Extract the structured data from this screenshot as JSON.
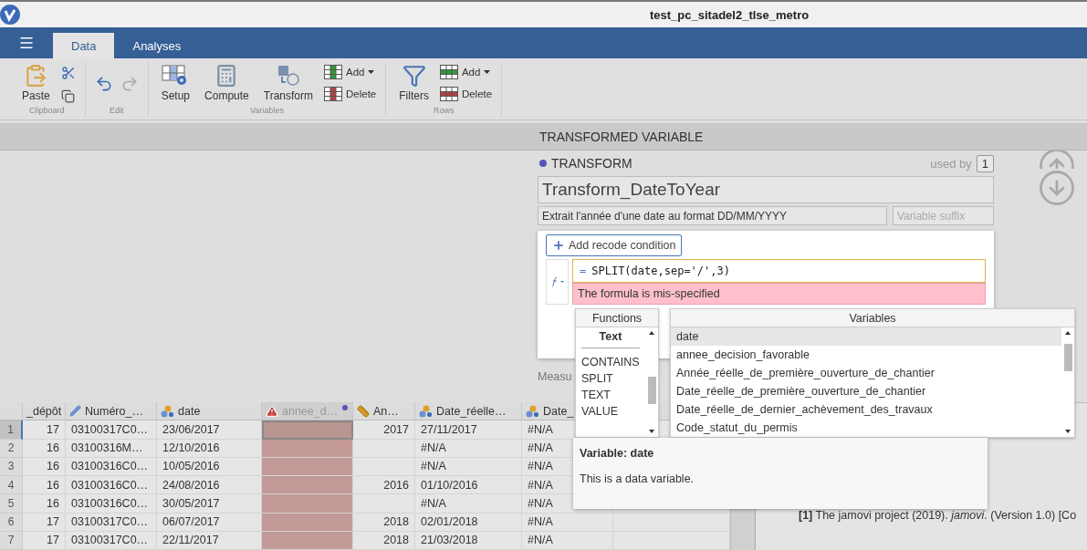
{
  "window": {
    "title": "test_pc_sitadel2_tlse_metro"
  },
  "tabs": [
    {
      "label": "Data",
      "selected": true
    },
    {
      "label": "Analyses",
      "selected": false
    }
  ],
  "ribbon": {
    "groups": [
      {
        "label": "Clipboard",
        "buttons": [
          {
            "kind": "paste",
            "label": "Paste"
          },
          {
            "kind": "cut"
          },
          {
            "kind": "copy"
          }
        ]
      },
      {
        "label": "Edit",
        "buttons": [
          {
            "kind": "undo",
            "disabled": false
          },
          {
            "kind": "redo",
            "disabled": true
          }
        ]
      },
      {
        "label": "Variables",
        "buttons": [
          {
            "kind": "setup",
            "label": "Setup"
          },
          {
            "kind": "compute",
            "label": "Compute"
          },
          {
            "kind": "transform",
            "label": "Transform"
          },
          {
            "kind": "add-col",
            "label": "Add"
          },
          {
            "kind": "delete-col",
            "label": "Delete"
          }
        ]
      },
      {
        "label": "Rows",
        "buttons": [
          {
            "kind": "filters",
            "label": "Filters"
          },
          {
            "kind": "add-row",
            "label": "Add"
          },
          {
            "kind": "delete-row",
            "label": "Delete"
          }
        ]
      }
    ]
  },
  "panel": {
    "title": "TRANSFORMED VARIABLE",
    "transform": {
      "heading": "TRANSFORM",
      "color": "#5555b8",
      "used_by_label": "used by",
      "used_by_count": "1",
      "name": "Transform_DateToYear",
      "description": "Extrait l'année d'une date au format DD/MM/YYYY",
      "suffix_placeholder": "Variable suffix",
      "add_condition": "Add recode condition",
      "formula_prefix": "=",
      "formula": "SPLIT(date,sep='/',3)",
      "error": "The formula is mis-specified"
    },
    "measure_label": "Measu"
  },
  "formula_popup": {
    "functions": {
      "title": "Functions",
      "category": "Text",
      "items": [
        "CONTAINS",
        "SPLIT",
        "TEXT",
        "VALUE"
      ]
    },
    "variables": {
      "title": "Variables",
      "items": [
        {
          "label": "date",
          "selected": true
        },
        {
          "label": "annee_decision_favorable",
          "selected": false
        },
        {
          "label": "Année_réelle_de_première_ouverture_de_chantier",
          "selected": false
        },
        {
          "label": "Date_réelle_de_première_ouverture_de_chantier",
          "selected": false
        },
        {
          "label": "Date_réelle_de_dernier_achèvement_des_travaux",
          "selected": false
        },
        {
          "label": "Code_statut_du_permis",
          "selected": false
        }
      ]
    },
    "detail_title": "Variable: date",
    "detail_text": "This is a data variable."
  },
  "table": {
    "columns": [
      {
        "label": "_dépôt",
        "kind": "plain"
      },
      {
        "label": "Numéro_…",
        "kind": "id"
      },
      {
        "label": "date",
        "kind": "nominal"
      },
      {
        "label": "annee_d…",
        "kind": "error"
      },
      {
        "label": "An…",
        "kind": "continuous"
      },
      {
        "label": "Date_réelle…",
        "kind": "nominal"
      },
      {
        "label": "Date_",
        "kind": "nominal"
      }
    ],
    "rows": [
      {
        "number": "1",
        "selected": true,
        "cells": [
          "17",
          "03100317C0…",
          "23/06/2017",
          null,
          "2017",
          "27/11/2017",
          "#N/A"
        ]
      },
      {
        "number": "2",
        "selected": false,
        "cells": [
          "16",
          "03100316M…",
          "12/10/2016",
          null,
          null,
          "#N/A",
          "#N/A"
        ]
      },
      {
        "number": "3",
        "selected": false,
        "cells": [
          "16",
          "03100316C0…",
          "10/05/2016",
          null,
          null,
          "#N/A",
          "#N/A"
        ]
      },
      {
        "number": "4",
        "selected": false,
        "cells": [
          "16",
          "03100316C0…",
          "24/08/2016",
          null,
          "2016",
          "01/10/2016",
          "#N/A"
        ]
      },
      {
        "number": "5",
        "selected": false,
        "cells": [
          "16",
          "03100316C0…",
          "30/05/2017",
          null,
          null,
          "#N/A",
          "#N/A"
        ]
      },
      {
        "number": "6",
        "selected": false,
        "cells": [
          "17",
          "03100317C0…",
          "06/07/2017",
          null,
          "2018",
          "02/01/2018",
          "#N/A"
        ]
      },
      {
        "number": "7",
        "selected": false,
        "cells": [
          "17",
          "03100317C0…",
          "22/11/2017",
          null,
          "2018",
          "21/03/2018",
          "#N/A"
        ]
      }
    ]
  },
  "results": {
    "references": [
      "**[1]** The jamovi project (2019). *jamovi*. (Version 1.0) [Co"
    ]
  }
}
